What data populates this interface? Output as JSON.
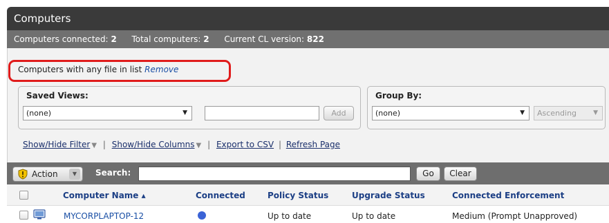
{
  "title": "Computers",
  "stats": {
    "connected_label": "Computers connected:",
    "connected_value": "2",
    "total_label": "Total computers:",
    "total_value": "2",
    "cl_label": "Current CL version:",
    "cl_value": "822"
  },
  "filter": {
    "text": "Computers with any file in list",
    "remove_label": "Remove"
  },
  "saved_views": {
    "title": "Saved Views:",
    "selected": "(none)",
    "name_value": "",
    "add_label": "Add"
  },
  "group_by": {
    "title": "Group By:",
    "selected": "(none)",
    "order": "Ascending"
  },
  "links": {
    "show_hide_filter": "Show/Hide Filter",
    "show_hide_columns": "Show/Hide Columns",
    "export_csv": "Export to CSV",
    "refresh": "Refresh Page"
  },
  "toolbar": {
    "action_label": "Action",
    "search_label": "Search:",
    "search_value": "",
    "go_label": "Go",
    "clear_label": "Clear"
  },
  "table": {
    "columns": [
      "Computer Name ▴",
      "Connected",
      "Policy Status",
      "Upgrade Status",
      "Connected Enforcement"
    ],
    "rows": [
      {
        "computer_name": "MYCORPLAPTOP-12",
        "policy_status": "Up to date",
        "upgrade_status": "Up to date",
        "enforcement": "Medium (Prompt Unapproved)"
      }
    ]
  },
  "colors": {
    "title_bar": "#3a3a3a",
    "stats_bar": "#707070",
    "highlight": "#e01b1b",
    "connected_dot": "#3b63d6",
    "link": "#1a4fa5"
  },
  "icons": {
    "action": "shield-icon",
    "computer": "monitor-icon",
    "dropdown": "chevron-down-icon"
  }
}
